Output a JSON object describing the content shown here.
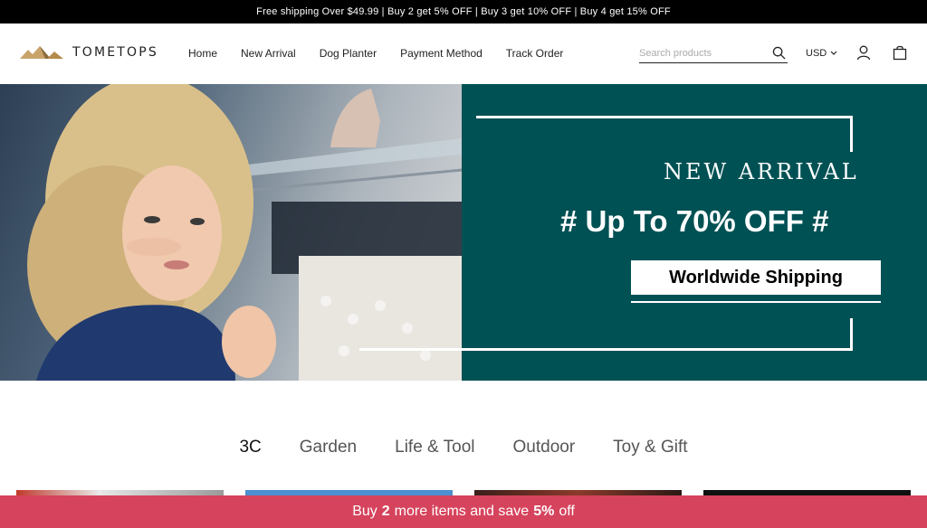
{
  "announcement": "Free shipping Over $49.99 | Buy 2 get 5% OFF | Buy 3 get 10% OFF | Buy 4 get 15% OFF",
  "logo": {
    "text": "TOMETOPS"
  },
  "nav": [
    {
      "label": "Home"
    },
    {
      "label": "New Arrival"
    },
    {
      "label": "Dog Planter"
    },
    {
      "label": "Payment Method"
    },
    {
      "label": "Track Order"
    }
  ],
  "search": {
    "placeholder": "Search products",
    "icon": "search-icon"
  },
  "currency": {
    "label": "USD",
    "icon": "chevron-down-icon"
  },
  "icons": {
    "account": "user-icon",
    "cart": "bag-icon"
  },
  "hero": {
    "title": "NEW ARRIVAL",
    "promo": "# Up To 70% OFF #",
    "shipping": "Worldwide Shipping",
    "panel_color": "#005154"
  },
  "tabs": [
    {
      "label": "3C",
      "active": true
    },
    {
      "label": "Garden",
      "active": false
    },
    {
      "label": "Life & Tool",
      "active": false
    },
    {
      "label": "Outdoor",
      "active": false
    },
    {
      "label": "Toy & Gift",
      "active": false
    }
  ],
  "promo_bar": {
    "prefix": "Buy",
    "count": "2",
    "middle": "more items and save",
    "percent": "5%",
    "suffix": "off",
    "color": "#d6435c"
  }
}
